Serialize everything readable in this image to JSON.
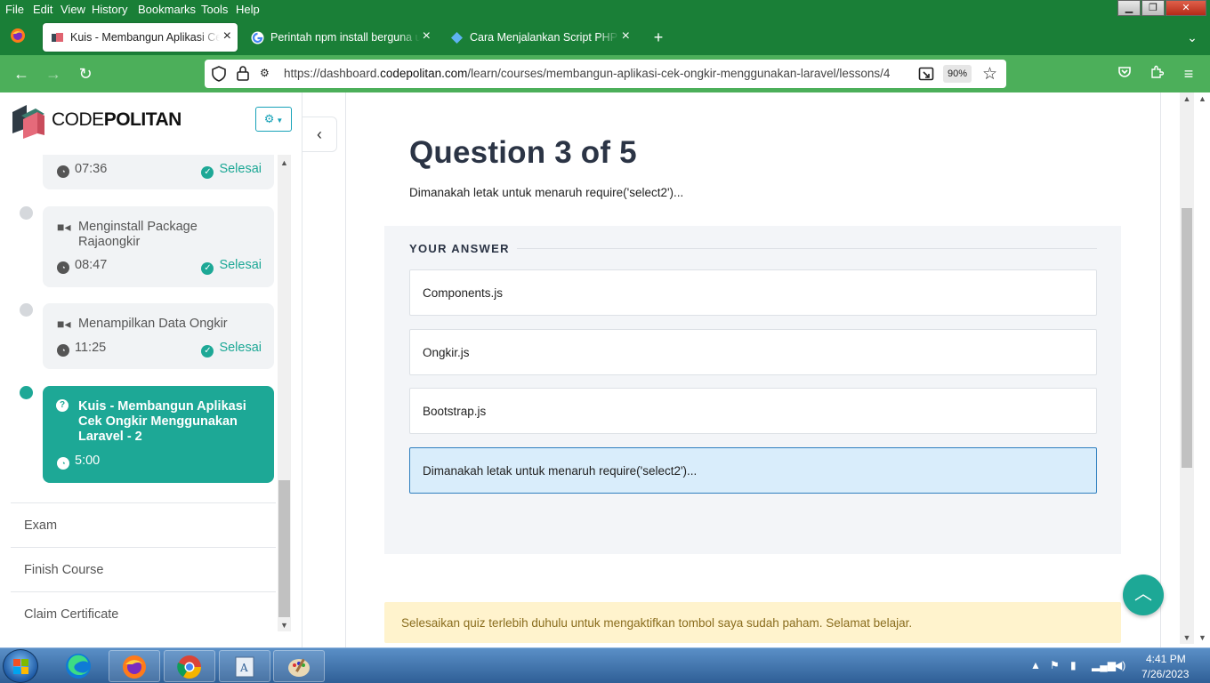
{
  "browser": {
    "menu": [
      "File",
      "Edit",
      "View",
      "History",
      "Bookmarks",
      "Tools",
      "Help"
    ],
    "tabs": [
      {
        "label": "Kuis - Membangun Aplikasi Cek Ongkir",
        "active": true
      },
      {
        "label": "Perintah npm install berguna untuk",
        "active": false
      },
      {
        "label": "Cara Menjalankan Script PHP di",
        "active": false
      }
    ],
    "url_prefix": "https://dashboard.",
    "url_domain": "codepolitan.com",
    "url_path": "/learn/courses/membangun-aplikasi-cek-ongkir-menggunakan-laravel/lessons/4",
    "zoom": "90%"
  },
  "sidebar": {
    "logo_text_bold": "CODE",
    "logo_text_rest": "POLITAN",
    "lessons": [
      {
        "title": "",
        "duration": "07:36",
        "status": "Selesai",
        "type": "video"
      },
      {
        "title": "Menginstall Package Rajaongkir",
        "duration": "08:47",
        "status": "Selesai",
        "type": "video"
      },
      {
        "title": "Menampilkan Data Ongkir",
        "duration": "11:25",
        "status": "Selesai",
        "type": "video"
      },
      {
        "title": "Kuis - Membangun Aplikasi Cek Ongkir Menggunakan Laravel - 2",
        "duration": "5:00",
        "status": "",
        "type": "quiz"
      }
    ],
    "links": [
      "Exam",
      "Finish Course",
      "Claim Certificate"
    ]
  },
  "quiz": {
    "title": "Question 3 of 5",
    "question": "Dimanakah letak untuk menaruh require('select2')...",
    "answer_label": "YOUR ANSWER",
    "options": [
      "Components.js",
      "Ongkir.js",
      "Bootstrap.js",
      "Dimanakah letak untuk menaruh require('select2')..."
    ],
    "selected_index": 3,
    "notice": "Selesaikan quiz terlebih duhulu untuk mengaktifkan tombol saya sudah paham. Selamat belajar."
  },
  "taskbar": {
    "time": "4:41 PM",
    "date": "7/26/2023"
  },
  "colors": {
    "browser_green": "#1a7f37",
    "nav_green": "#4caf5a",
    "accent_teal": "#1da896",
    "selected_blue": "#d9edfb",
    "notice_bg": "#fff3cd"
  }
}
